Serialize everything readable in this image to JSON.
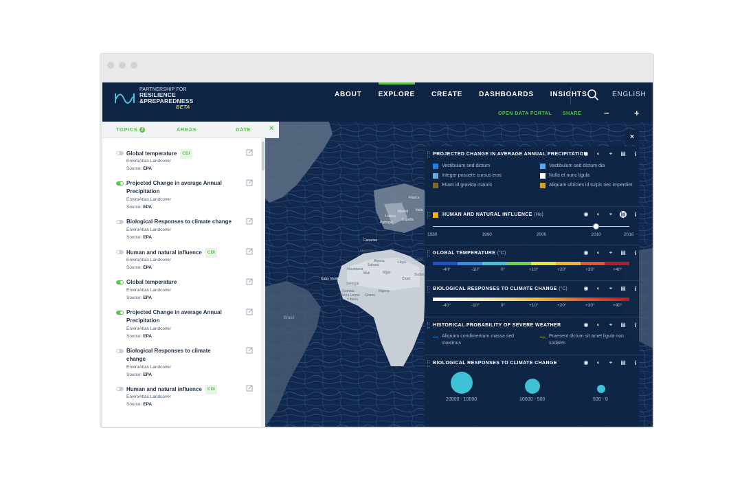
{
  "brand": {
    "line1": "PARTNERSHIP FOR",
    "line2": "RESILIENCE",
    "line3": "&PREPAREDNESS",
    "badge": "BETA"
  },
  "nav": {
    "items": [
      "ABOUT",
      "EXPLORE",
      "CREATE",
      "DASHBOARDS",
      "INSIGHTS"
    ],
    "active": "EXPLORE",
    "language": "ENGLISH"
  },
  "subbar": {
    "open_data": "OPEN DATA PORTAL",
    "share": "SHARE",
    "zoom_out": "−",
    "zoom_in": "+"
  },
  "sidebar": {
    "tabs": [
      "TOPICS",
      "AREAS",
      "DATE"
    ],
    "topics_badge": "2",
    "close": "×",
    "items": [
      {
        "title": "Global temperature",
        "badge": "CDI",
        "on": false,
        "sub": "EnviroAtlas Landcover",
        "source_label": "Source:",
        "source": "EPA"
      },
      {
        "title": "Projected Change in average Annual Precipitation",
        "badge": "",
        "on": true,
        "sub": "EnviroAtlas Landcover",
        "source_label": "Source:",
        "source": "EPA"
      },
      {
        "title": "Biological Responses to climate change",
        "badge": "",
        "on": false,
        "sub": "EnviroAtlas Landcover",
        "source_label": "Source:",
        "source": "EPA"
      },
      {
        "title": "Human and natural influence",
        "badge": "CDI",
        "on": false,
        "sub": "EnviroAtlas Landcover",
        "source_label": "Source:",
        "source": "EPA"
      },
      {
        "title": "Global temperature",
        "badge": "",
        "on": true,
        "sub": "EnviroAtlas Landcover",
        "source_label": "Source:",
        "source": "EPA"
      },
      {
        "title": "Projected Change in average Annual Precipitation",
        "badge": "",
        "on": true,
        "sub": "EnviroAtlas Landcover",
        "source_label": "Source:",
        "source": "EPA"
      },
      {
        "title": "Biological Responses to climate change",
        "badge": "",
        "on": false,
        "sub": "EnviroAtlas Landcover",
        "source_label": "Source:",
        "source": "EPA"
      },
      {
        "title": "Human and natural influence",
        "badge": "CDI",
        "on": false,
        "sub": "EnviroAtlas Landcover",
        "source_label": "Source:",
        "source": "EPA"
      }
    ]
  },
  "map_labels": [
    "Brasil",
    "Cabo Verde",
    "Senegal",
    "Gambia",
    "Sierra Leone",
    "Liberia",
    "Mali",
    "Niger",
    "Nigeria",
    "Ghana",
    "Chad",
    "Sudan",
    "Egypt",
    "Libya",
    "Algeria",
    "Morocco",
    "Mauritania",
    "Sahara",
    "Lisboa",
    "Madrid",
    "Portugal",
    "España",
    "France",
    "Italia",
    "Canarias"
  ],
  "legend": {
    "close": "×",
    "precip": {
      "title": "PROJECTED CHANGE IN AVERAGE ANNUAL PRECIPITATION",
      "items": [
        {
          "label": "Vestibulum sed dictum",
          "color": "#1f7fe0"
        },
        {
          "label": "Vestibulum sed dictum dia",
          "color": "#58a9f0"
        },
        {
          "label": "Integer posuere cursus eros",
          "color": "#6aa9d8"
        },
        {
          "label": "Nulla et nunc ligula",
          "color": "#ffffff"
        },
        {
          "label": "Etiam id gravida mauris",
          "color": "#7b6a2a"
        },
        {
          "label": "Aliquam ultricies id turpis nec imperdiet",
          "color": "#d9a21b"
        }
      ]
    },
    "human": {
      "title": "HUMAN AND NATURAL INFLUENCE",
      "unit": "(Ha)",
      "color": "#f2b01e",
      "ticks": [
        "1980",
        "1990",
        "2000",
        "2010",
        "2016"
      ],
      "slider_value": 2010,
      "range": [
        1980,
        2016
      ]
    },
    "temp": {
      "title": "GLOBAL TEMPERATURE",
      "unit": "(°C)",
      "ticks": [
        "-40°",
        "-10°",
        "0°",
        "+10°",
        "+20°",
        "+30°",
        "+40°"
      ],
      "colors": [
        "#1e4fd8",
        "#2f8fe6",
        "#3cc3d8",
        "#6fd24a",
        "#e8e43a",
        "#f2b332",
        "#e2572f",
        "#b81d22"
      ]
    },
    "bio": {
      "title": "BIOLOGICAL RESPONSES TO CLIMATE CHANGE",
      "unit": "(°C)",
      "ticks": [
        "-40°",
        "-10°",
        "0°",
        "+10°",
        "+20°",
        "+30°",
        "+40°"
      ]
    },
    "severe": {
      "title": "HISTORICAL PROBABILITY OF SEVERE WEATHER",
      "items": [
        {
          "label": "Aliquam condimentum massa sed maximus",
          "color": "#2f8fe6"
        },
        {
          "label": "Praesent dictum sit amet ligula non sodales",
          "color": "#c8d83a"
        }
      ]
    },
    "bio2": {
      "title": "BIOLOGICAL RESPONSES TO CLIMATE CHANGE",
      "bubbles": [
        "20000 - 10000",
        "10000 - 500",
        "500 - 0"
      ]
    }
  }
}
